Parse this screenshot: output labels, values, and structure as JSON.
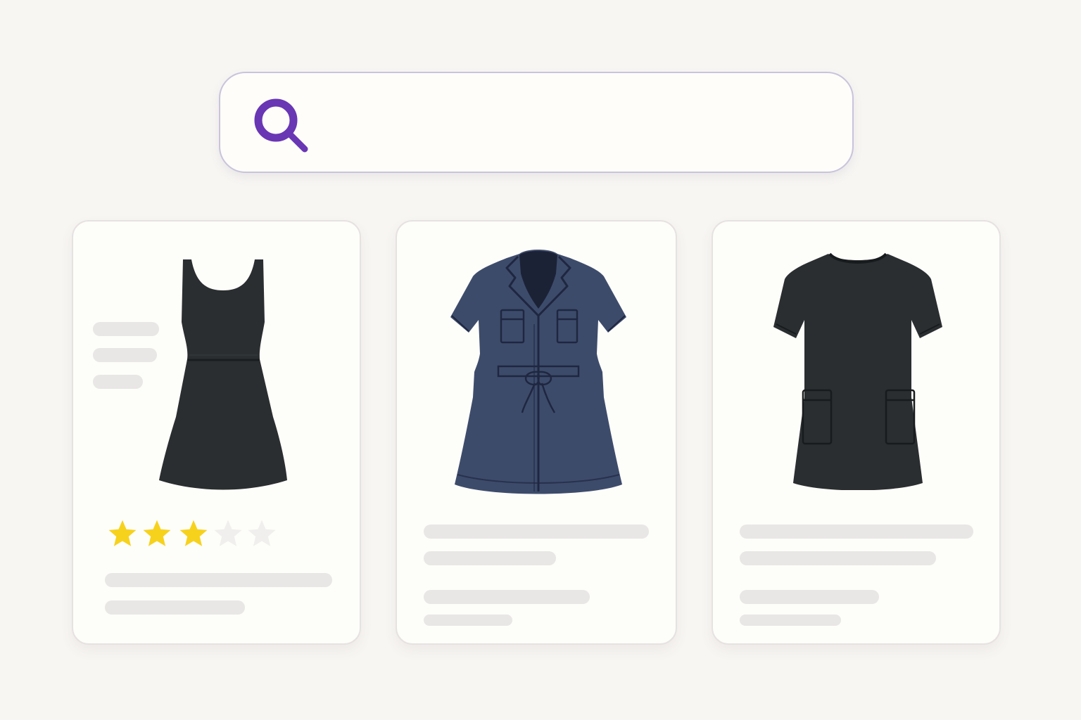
{
  "colors": {
    "background": "#f8f6f3",
    "accent": "#6936b4",
    "search_border": "#c9c3dc",
    "card_background": "#fdfdf9",
    "skeleton": "#e9e6e6",
    "star_filled": "#f7d21c",
    "star_empty": "#f1eeee",
    "dress_black": "#2a2e30",
    "dress_navy": "#3d4b6b"
  },
  "search": {
    "value": "",
    "icon": "search-icon"
  },
  "products": [
    {
      "image_icon": "sleeveless-dress-icon",
      "rating": 3,
      "rating_max": 5
    },
    {
      "image_icon": "shirt-dress-icon"
    },
    {
      "image_icon": "tshirt-dress-icon"
    }
  ]
}
